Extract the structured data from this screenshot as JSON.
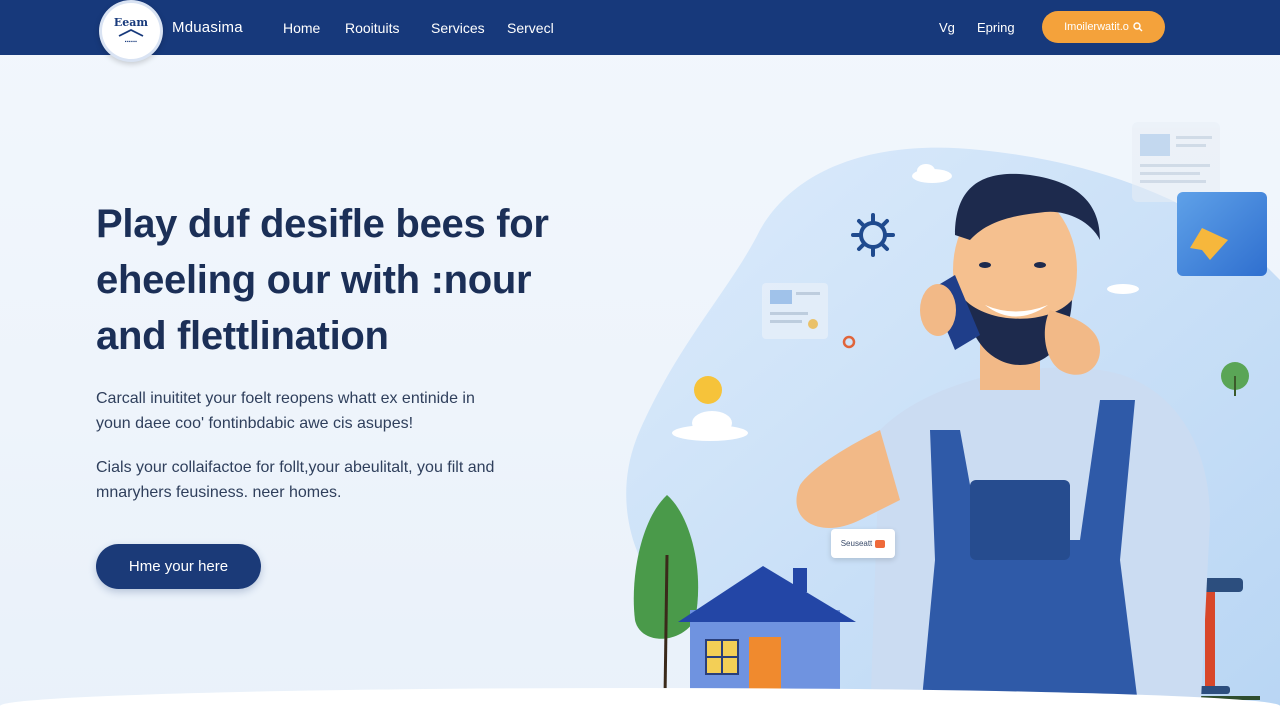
{
  "header": {
    "logo_text": "Eeam",
    "brand": "Mduasima",
    "nav": [
      "Home",
      "Rooituits",
      "Services",
      "Servecl"
    ],
    "lang": "Vg",
    "link": "Epring",
    "cta_label": "Imoilerwatit.o"
  },
  "hero": {
    "headline_lines": [
      "Play duf desifle bees for",
      "eheeling our with :nour",
      "and flettlination"
    ],
    "paragraph1_lines": [
      "Carcall inuititet your foelt reopens whatt ex entinide in",
      "youn daee coo' fontinbdabic awe cis asupes!"
    ],
    "paragraph2_lines": [
      "Cials your collaifactoe for follt,your abeulitalt, you filt and",
      "mnaryhers feusiness. neer homes."
    ],
    "button_label": "Hme your here"
  },
  "illustration": {
    "badge_text": "Seuseatt"
  },
  "colors": {
    "header_bg": "#17397b",
    "accent_orange": "#f4a23b",
    "primary_button": "#1b3a78",
    "blob": "#cfe3f8"
  },
  "icons": [
    "search-icon",
    "gear-icon",
    "star-icon",
    "sun-icon",
    "cloud-icon",
    "tree-icon",
    "house-icon",
    "phone-icon",
    "plunger-icon"
  ]
}
